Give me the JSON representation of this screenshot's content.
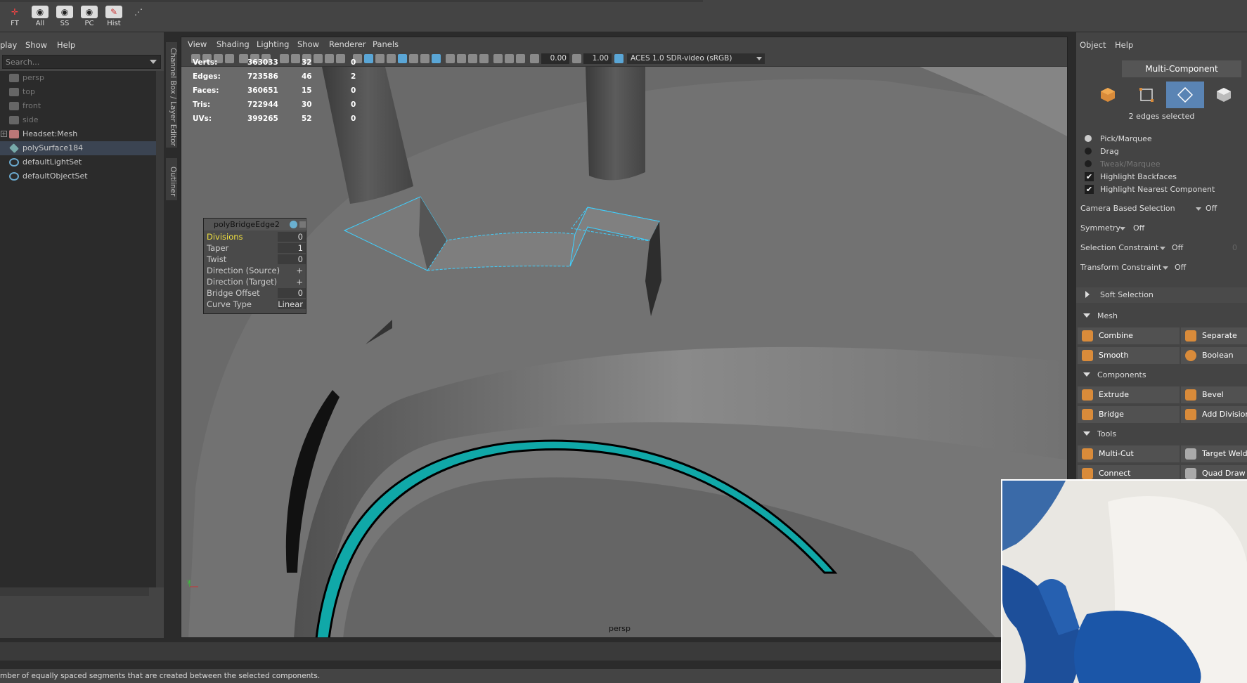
{
  "shelf": {
    "buttons": [
      {
        "label": "FT",
        "icon": "axis-icon"
      },
      {
        "label": "All",
        "icon": "eye-icon"
      },
      {
        "label": "SS",
        "icon": "eye-icon"
      },
      {
        "label": "PC",
        "icon": "eye-icon"
      },
      {
        "label": "Hist",
        "icon": "history-icon"
      }
    ]
  },
  "outliner": {
    "menu": [
      "play",
      "Show",
      "Help"
    ],
    "search_placeholder": "Search...",
    "items": [
      {
        "label": "persp",
        "icon": "camera-icon",
        "dim": true
      },
      {
        "label": "top",
        "icon": "camera-icon",
        "dim": true
      },
      {
        "label": "front",
        "icon": "camera-icon",
        "dim": true
      },
      {
        "label": "side",
        "icon": "camera-icon",
        "dim": true
      },
      {
        "label": "Headset:Mesh",
        "icon": "mesh-group-icon",
        "dim": false
      },
      {
        "label": "polySurface184",
        "icon": "poly-surface-icon",
        "dim": false,
        "selected": true
      },
      {
        "label": "defaultLightSet",
        "icon": "set-icon",
        "dim": false
      },
      {
        "label": "defaultObjectSet",
        "icon": "set-icon",
        "dim": false
      }
    ]
  },
  "side_tabs": {
    "channel_box": "Channel Box / Layer Editor",
    "outliner": "Outliner"
  },
  "viewport": {
    "menu": [
      "View",
      "Shading",
      "Lighting",
      "Show",
      "Renderer",
      "Panels"
    ],
    "toolbar": {
      "exposure": "0.00",
      "gamma": "1.00",
      "colorspace": "ACES 1.0 SDR-video (sRGB)"
    },
    "hud": [
      {
        "label": "Verts:",
        "total": "363033",
        "sel": "32",
        "obj": "0"
      },
      {
        "label": "Edges:",
        "total": "723586",
        "sel": "46",
        "obj": "2"
      },
      {
        "label": "Faces:",
        "total": "360651",
        "sel": "15",
        "obj": "0"
      },
      {
        "label": "Tris:",
        "total": "722944",
        "sel": "30",
        "obj": "0"
      },
      {
        "label": "UVs:",
        "total": "399265",
        "sel": "52",
        "obj": "0"
      }
    ],
    "camera_label": "persp"
  },
  "popup": {
    "title": "polyBridgeEdge2",
    "rows": [
      {
        "name": "Divisions",
        "value": "0",
        "highlight": true
      },
      {
        "name": "Taper",
        "value": "1"
      },
      {
        "name": "Twist",
        "value": "0"
      },
      {
        "name": "Direction (Source)",
        "value": "+"
      },
      {
        "name": "Direction (Target)",
        "value": "+"
      },
      {
        "name": "Bridge Offset",
        "value": "0"
      },
      {
        "name": "Curve Type",
        "value": "Linear"
      }
    ]
  },
  "modeling_toolkit": {
    "menu": [
      "Object",
      "Help"
    ],
    "mode_title": "Multi-Component",
    "selection_info": "2 edges selected",
    "pick_marquee": "Pick/Marquee",
    "drag": "Drag",
    "tweak_marquee": "Tweak/Marquee",
    "highlight_backfaces": "Highlight Backfaces",
    "highlight_nearest": "Highlight Nearest Component",
    "camera_based_selection": {
      "label": "Camera Based Selection",
      "value": "Off"
    },
    "symmetry": {
      "label": "Symmetry",
      "value": "Off"
    },
    "selection_constraint": {
      "label": "Selection Constraint",
      "value": "Off",
      "extra": "0"
    },
    "transform_constraint": {
      "label": "Transform Constraint",
      "value": "Off"
    },
    "soft_selection": "Soft Selection",
    "mesh_section": "Mesh",
    "combine": "Combine",
    "separate": "Separate",
    "smooth": "Smooth",
    "boolean": "Boolean",
    "components_section": "Components",
    "extrude": "Extrude",
    "bevel": "Bevel",
    "bridge": "Bridge",
    "add_divisions": "Add Divisions",
    "tools_section": "Tools",
    "multi_cut": "Multi-Cut",
    "target_weld": "Target Weld",
    "connect": "Connect",
    "quad_draw": "Quad Draw"
  },
  "help_line": "mber of equally spaced segments that are created between the selected components.",
  "colors": {
    "panel": "#444444",
    "viewport": "#6c6c6c",
    "selection_blue": "#5aa6d6",
    "highlight_yellow": "#f0e040",
    "accent_orange": "#d98b3a"
  }
}
